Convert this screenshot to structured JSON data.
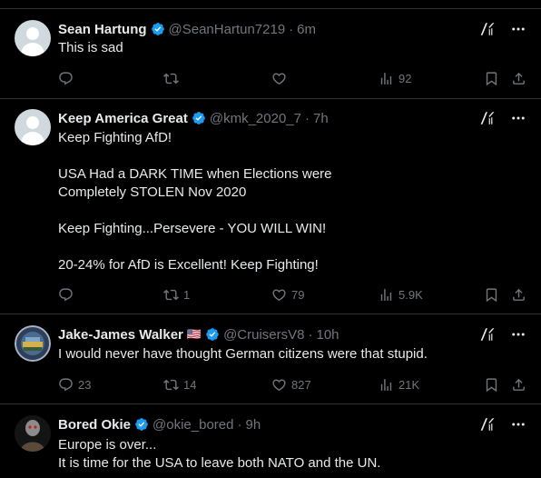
{
  "tweets": [
    {
      "name": "Sean Hartung",
      "handle": "@SeanHartun7219",
      "time": "6m",
      "text": "This is sad",
      "reply_count": "",
      "retweet_count": "",
      "like_count": "",
      "view_count": "92"
    },
    {
      "name": "Keep America Great",
      "handle": "@kmk_2020_7",
      "time": "7h",
      "text": "Keep Fighting AfD!\n\nUSA Had a DARK TIME when Elections were\nCompletely STOLEN Nov 2020\n\nKeep Fighting...Persevere - YOU WILL WIN!\n\n20-24% for AfD is Excellent!  Keep Fighting!",
      "reply_count": "",
      "retweet_count": "1",
      "like_count": "79",
      "view_count": "5.9K"
    },
    {
      "name": "Jake-James Walker",
      "flag": "🇺🇸",
      "handle": "@CruisersV8",
      "time": "10h",
      "text": "I would never have thought German citizens were that stupid.",
      "reply_count": "23",
      "retweet_count": "14",
      "like_count": "827",
      "view_count": "21K"
    },
    {
      "name": "Bored Okie",
      "handle": "@okie_bored",
      "time": "9h",
      "text": "Europe is over...\nIt is time for the USA to leave both NATO and the UN."
    }
  ],
  "separator": "·",
  "colors": {
    "verified": "#1d9bf0",
    "muted": "#71767b",
    "text": "#e7e9ea",
    "border": "#2f3336"
  }
}
